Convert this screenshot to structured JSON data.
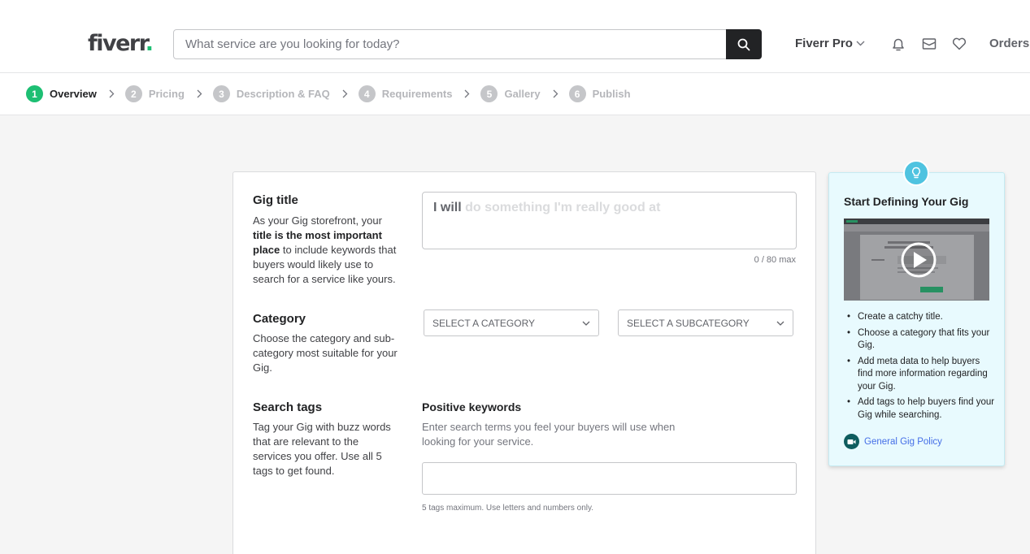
{
  "header": {
    "logo_text": "fiverr",
    "logo_dot": ".",
    "search_placeholder": "What service are you looking for today?",
    "pro_label": "Fiverr Pro",
    "orders_label": "Orders"
  },
  "steps": [
    {
      "num": "1",
      "label": "Overview",
      "active": true
    },
    {
      "num": "2",
      "label": "Pricing",
      "active": false
    },
    {
      "num": "3",
      "label": "Description & FAQ",
      "active": false
    },
    {
      "num": "4",
      "label": "Requirements",
      "active": false
    },
    {
      "num": "5",
      "label": "Gallery",
      "active": false
    },
    {
      "num": "6",
      "label": "Publish",
      "active": false
    }
  ],
  "gig_title": {
    "title": "Gig title",
    "desc_1": "As your Gig storefront, your ",
    "desc_bold": "title is the most important place",
    "desc_2": " to include keywords that buyers would likely use to search for a service like yours.",
    "prefix": "I will",
    "placeholder": "do something I'm really good at",
    "counter": "0 / 80 max"
  },
  "category": {
    "title": "Category",
    "desc": "Choose the category and sub-category most suitable for your Gig.",
    "select_category": "SELECT A CATEGORY",
    "select_subcategory": "SELECT A SUBCATEGORY"
  },
  "search_tags": {
    "title": "Search tags",
    "desc": "Tag your Gig with buzz words that are relevant to the services you offer. Use all 5 tags to get found.",
    "keywords_title": "Positive keywords",
    "keywords_desc": "Enter search terms you feel your buyers will use when looking for your service.",
    "note": "5 tags maximum. Use letters and numbers only."
  },
  "tip": {
    "title": "Start Defining Your Gig",
    "items": [
      "Create a catchy title.",
      "Choose a category that fits your Gig.",
      "Add meta data to help buyers find more information regarding your Gig.",
      "Add tags to help buyers find your Gig while searching."
    ],
    "link": "General Gig Policy"
  },
  "colors": {
    "brand_green": "#1dbf73",
    "tip_background": "#e8fafe",
    "link_blue": "#446ee7"
  }
}
